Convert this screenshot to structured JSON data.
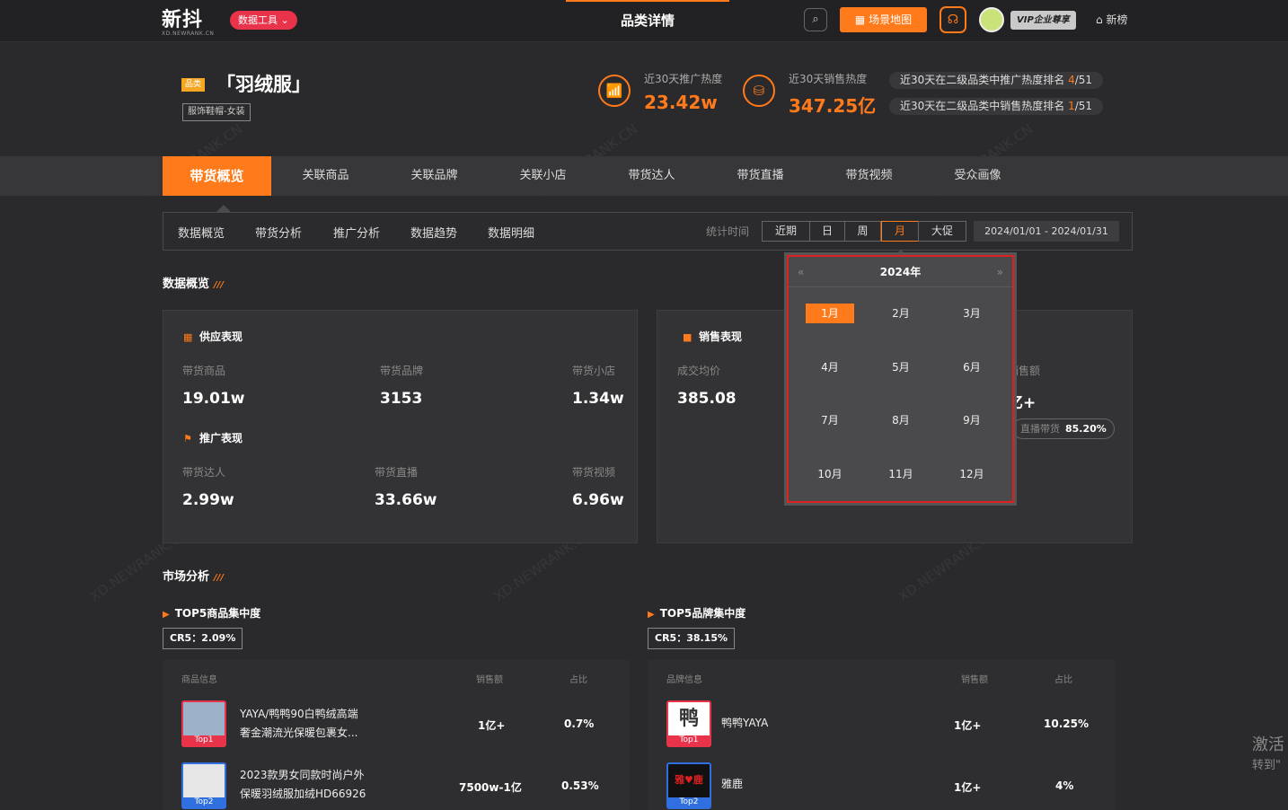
{
  "header": {
    "logo_main": "新抖",
    "logo_sub": "XD.NEWRANK.CN",
    "tools_label": "数据工具 ⌄",
    "page_title": "品类详情",
    "map_label": "场景地图",
    "vip_label": "VIP企业尊享",
    "newrank_label": "新榜"
  },
  "category": {
    "badge": "品类",
    "title": "「羽绒服」",
    "path": "服饰鞋帽-女装",
    "promo_label": "近30天推广热度",
    "promo_value": "23.42w",
    "sales_label": "近30天销售热度",
    "sales_value": "347.25亿",
    "promo_rank_text": "近30天在二级品类中推广热度排名",
    "promo_rank": "4",
    "promo_rank_total": "/51",
    "sales_rank_text": "近30天在二级品类中销售热度排名",
    "sales_rank": "1",
    "sales_rank_total": "/51"
  },
  "nav": {
    "items": [
      "带货概览",
      "关联商品",
      "关联品牌",
      "关联小店",
      "带货达人",
      "带货直播",
      "带货视频",
      "受众画像"
    ]
  },
  "subnav": {
    "items": [
      "数据概览",
      "带货分析",
      "推广分析",
      "数据趋势",
      "数据明细"
    ],
    "stat_label": "统计时间",
    "periods": [
      "近期",
      "日",
      "周",
      "月",
      "大促"
    ],
    "active_period": "月",
    "date_range": "2024/01/01 - 2024/01/31"
  },
  "overview": {
    "title": "数据概览",
    "supply": {
      "title": "供应表现",
      "labels": [
        "带货商品",
        "带货品牌",
        "带货小店"
      ],
      "values": [
        "19.01w",
        "3153",
        "1.34w"
      ]
    },
    "promo": {
      "title": "推广表现",
      "labels": [
        "带货达人",
        "带货直播",
        "带货视频"
      ],
      "values": [
        "2.99w",
        "33.66w",
        "6.96w"
      ]
    },
    "sales": {
      "title": "销售表现",
      "avg_label": "成交均价",
      "avg_value": "385.08",
      "amount_label": "销售额",
      "amount_value": "亿+",
      "live_label": "直播带货",
      "live_value": "85.20%"
    }
  },
  "picker": {
    "year": "2024年",
    "prev": "«",
    "next": "»",
    "months": [
      "1月",
      "2月",
      "3月",
      "4月",
      "5月",
      "6月",
      "7月",
      "8月",
      "9月",
      "10月",
      "11月",
      "12月"
    ],
    "active_month": "1月"
  },
  "market": {
    "title": "市场分析",
    "products": {
      "title": "TOP5商品集中度",
      "cr": "CR5：2.09%",
      "headers": [
        "商品信息",
        "销售额",
        "占比"
      ],
      "rows": [
        {
          "name_line1": "YAYA/鸭鸭90白鸭绒高端",
          "name_line2": "奢金潮流光保暖包裹女...",
          "sales": "1亿+",
          "share": "0.7%",
          "tag": "Top1"
        },
        {
          "name_line1": "2023款男女同款时尚户外",
          "name_line2": "保暖羽绒服加绒HD66926",
          "sales": "7500w-1亿",
          "share": "0.53%",
          "tag": "Top2"
        }
      ]
    },
    "brands": {
      "title": "TOP5品牌集中度",
      "cr": "CR5：38.15%",
      "headers": [
        "品牌信息",
        "销售额",
        "占比"
      ],
      "rows": [
        {
          "name": "鸭鸭YAYA",
          "sales": "1亿+",
          "share": "10.25%",
          "tag": "Top1",
          "logo_text": "鸭"
        },
        {
          "name": "雅鹿",
          "sales": "1亿+",
          "share": "4%",
          "tag": "Top2",
          "logo_text": "雅♥鹿"
        }
      ]
    }
  },
  "watermarks": {
    "text1": "XD.NEWRANK.CN",
    "text2": "新榜有数 · 新抖"
  },
  "os_overlay": {
    "line1": "激活",
    "line2": "转到\""
  },
  "colors": {
    "accent": "#ff7a1a",
    "danger": "#e8334a",
    "background": "#2a2a2c"
  }
}
